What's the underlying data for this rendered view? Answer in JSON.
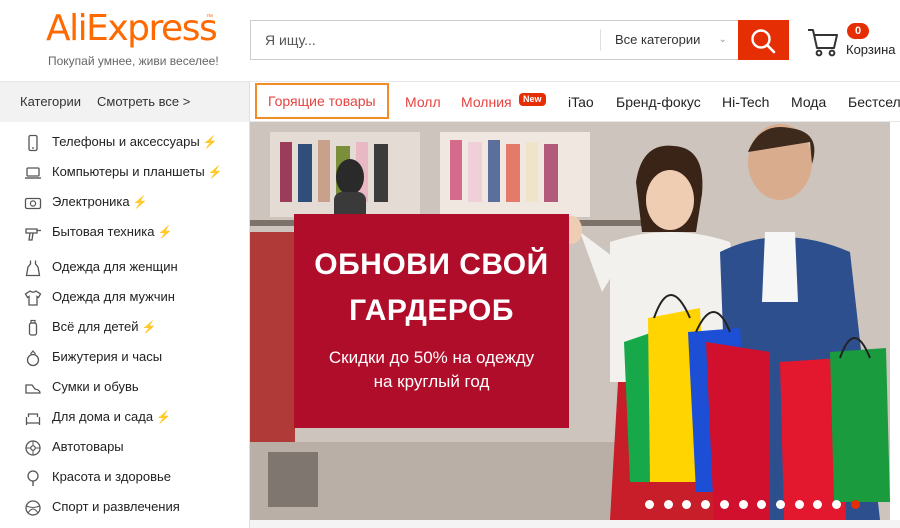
{
  "header": {
    "logo_text": "AliExpress",
    "logo_tm": "™",
    "slogan": "Покупай умнее, живи веселее!",
    "search_placeholder": "Я ищу...",
    "category_select": "Все категории",
    "cart_count": "0",
    "cart_label": "Корзина"
  },
  "nav": {
    "categories_label": "Категории",
    "see_all_label": "Смотреть все >",
    "items": [
      {
        "label": "Горящие товары"
      },
      {
        "label": "Молл"
      },
      {
        "label": "Молния"
      },
      {
        "label": "iTao"
      },
      {
        "label": "Бренд-фокус"
      },
      {
        "label": "Hi-Tech"
      },
      {
        "label": "Мода"
      },
      {
        "label": "Бестсел"
      }
    ],
    "new_badge": "New"
  },
  "sidebar": {
    "items": [
      {
        "label": "Телефоны и аксессуары",
        "icon": "phone-icon",
        "bolt": true
      },
      {
        "label": "Компьютеры и планшеты",
        "icon": "laptop-icon",
        "bolt": true
      },
      {
        "label": "Электроника",
        "icon": "camera-icon",
        "bolt": true
      },
      {
        "label": "Бытовая техника",
        "icon": "drill-icon",
        "bolt": true
      },
      {
        "label": "Одежда для женщин",
        "icon": "dress-icon",
        "bolt": false
      },
      {
        "label": "Одежда для мужчин",
        "icon": "shirt-icon",
        "bolt": false
      },
      {
        "label": "Всё для детей",
        "icon": "baby-icon",
        "bolt": true
      },
      {
        "label": "Бижутерия и часы",
        "icon": "ring-icon",
        "bolt": false
      },
      {
        "label": "Сумки и обувь",
        "icon": "shoe-icon",
        "bolt": false
      },
      {
        "label": "Для дома и сада",
        "icon": "sofa-icon",
        "bolt": true
      },
      {
        "label": "Автотовары",
        "icon": "wheel-icon",
        "bolt": false
      },
      {
        "label": "Красота и здоровье",
        "icon": "mirror-icon",
        "bolt": false
      },
      {
        "label": "Спорт и развлечения",
        "icon": "ball-icon",
        "bolt": false
      }
    ],
    "bolt_glyph": "⚡"
  },
  "banner": {
    "title_line1": "ОБНОВИ СВОЙ",
    "title_line2": "ГАРДЕРОБ",
    "subtitle_line1": "Скидки до 50% на одежду",
    "subtitle_line2": "на круглый год",
    "promo_color": "#b00d2b",
    "slide_count": 12,
    "active_slide": 12
  },
  "colors": {
    "accent": "#e62e04",
    "brand_orange": "#ff6a00",
    "hot_link": "#e64340",
    "active_outline": "#f28c28",
    "bolt": "#f5b100"
  }
}
